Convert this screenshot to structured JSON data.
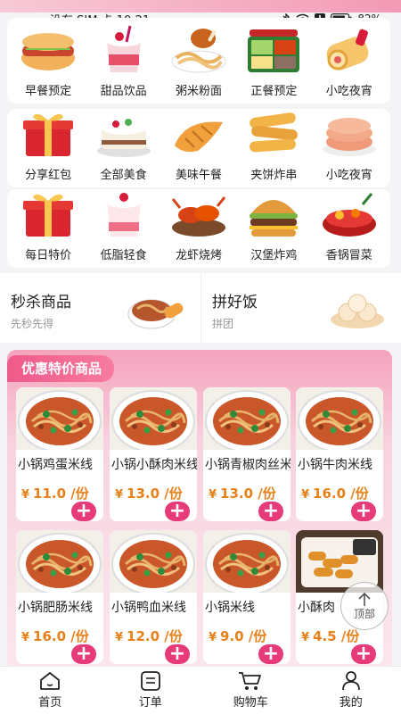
{
  "status_bar": {
    "carrier_time": "没有 SIM 卡 10:21",
    "battery": "82%",
    "icons": [
      "bluetooth-icon",
      "wifi-icon",
      "alert-icon",
      "battery-icon"
    ]
  },
  "categories": {
    "row1": [
      {
        "label": "早餐预定",
        "icon": "hotdog-sandwich"
      },
      {
        "label": "甜品饮品",
        "icon": "dessert-cup"
      },
      {
        "label": "粥米粉面",
        "icon": "noodles-chicken"
      },
      {
        "label": "正餐预定",
        "icon": "bento-box"
      },
      {
        "label": "小吃夜宵",
        "icon": "roll-snack"
      }
    ],
    "row2": [
      {
        "label": "分享红包",
        "icon": "gift-box"
      },
      {
        "label": "全部美食",
        "icon": "cake"
      },
      {
        "label": "美味午餐",
        "icon": "croissant"
      },
      {
        "label": "夹饼炸串",
        "icon": "fried-dough"
      },
      {
        "label": "小吃夜宵",
        "icon": "pancakes"
      }
    ],
    "row3": [
      {
        "label": "每日特价",
        "icon": "gift-box"
      },
      {
        "label": "低脂轻食",
        "icon": "yogurt-cup"
      },
      {
        "label": "龙虾烧烤",
        "icon": "crayfish"
      },
      {
        "label": "汉堡炸鸡",
        "icon": "burger"
      },
      {
        "label": "香锅冒菜",
        "icon": "spicy-pot"
      }
    ]
  },
  "promos": [
    {
      "title": "秒杀商品",
      "subtitle": "先秒先得"
    },
    {
      "title": "拼好饭",
      "subtitle": "拼团"
    }
  ],
  "deals": {
    "title": "优惠特价商品",
    "currency": "¥",
    "products": [
      {
        "name": "小锅鸡蛋米线",
        "price": "11.0 /份"
      },
      {
        "name": "小锅小酥肉米线",
        "price": "13.0 /份"
      },
      {
        "name": "小锅青椒肉丝米线",
        "price": "13.0 /份"
      },
      {
        "name": "小锅牛肉米线",
        "price": "16.0 /份"
      },
      {
        "name": "小锅肥肠米线",
        "price": "16.0 /份"
      },
      {
        "name": "小锅鸭血米线",
        "price": "12.0 /份"
      },
      {
        "name": "小锅米线",
        "price": "9.0 /份"
      },
      {
        "name": "小酥肉",
        "price": "4.5 /份"
      }
    ],
    "add_symbol": "+"
  },
  "back_to_top": "顶部",
  "tabbar": [
    {
      "label": "首页",
      "icon": "home-icon"
    },
    {
      "label": "订单",
      "icon": "order-icon"
    },
    {
      "label": "购物车",
      "icon": "cart-icon"
    },
    {
      "label": "我的",
      "icon": "profile-icon"
    }
  ],
  "colors": {
    "accent_pink": "#e63b78",
    "price_orange": "#e8801a",
    "deals_header": "#ee5a8a"
  }
}
